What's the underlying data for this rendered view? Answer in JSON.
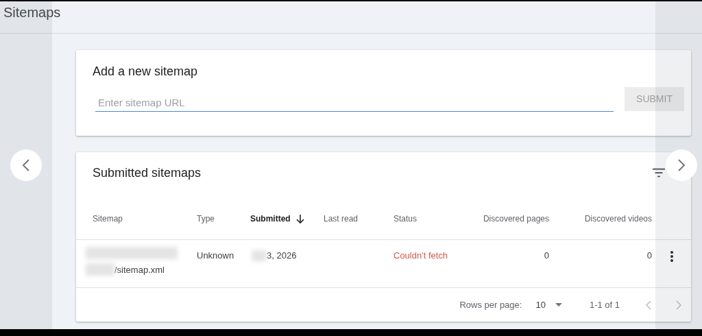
{
  "page": {
    "title": "Sitemaps"
  },
  "add_sitemap": {
    "title": "Add a new sitemap",
    "placeholder": "Enter sitemap URL",
    "submit": "SUBMIT"
  },
  "submitted_sitemaps": {
    "title": "Submitted sitemaps",
    "columns": [
      {
        "label": "Sitemap",
        "sorted": false,
        "kind": "text"
      },
      {
        "label": "Type",
        "sorted": false,
        "kind": "text"
      },
      {
        "label": "Submitted",
        "sorted": true,
        "kind": "text"
      },
      {
        "label": "Last read",
        "sorted": false,
        "kind": "text"
      },
      {
        "label": "Status",
        "sorted": false,
        "kind": "text"
      },
      {
        "label": "Discovered pages",
        "sorted": false,
        "kind": "number"
      },
      {
        "label": "Discovered videos",
        "sorted": false,
        "kind": "number"
      }
    ],
    "rows": [
      {
        "sitemap": "/sitemap.xml",
        "type": "Unknown",
        "submitted": "3, 2026",
        "status": "Couldn't fetch",
        "error": true,
        "pages": "0",
        "videos": "0"
      }
    ],
    "footer": {
      "rows_per_page_label": "Rows per page:",
      "rows_per_page": "10",
      "range": "1-1 of 1"
    }
  }
}
